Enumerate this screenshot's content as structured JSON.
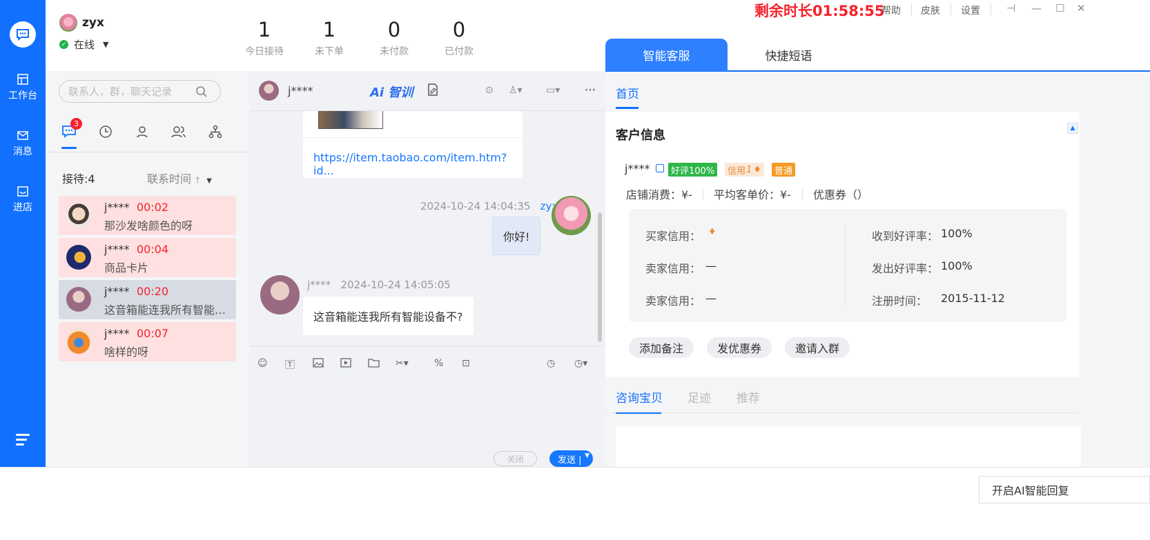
{
  "nav": {
    "items": [
      {
        "label": "工作台",
        "icon": "workbench-icon"
      },
      {
        "label": "消息",
        "icon": "mail-icon"
      },
      {
        "label": "进店",
        "icon": "store-icon"
      }
    ]
  },
  "header": {
    "user_name": "zyx",
    "status": "在线",
    "stats": [
      {
        "value": "1",
        "label": "今日接待"
      },
      {
        "value": "1",
        "label": "未下单"
      },
      {
        "value": "0",
        "label": "未付款"
      },
      {
        "value": "0",
        "label": "已付款"
      }
    ],
    "timer": "剩余时长01:58:55",
    "links": {
      "help": "帮助",
      "skin": "皮肤",
      "settings": "设置"
    }
  },
  "contacts": {
    "search_placeholder": "联系人，群，聊天记录",
    "badge": "3",
    "queue_label": "接待:4",
    "sort_label": "联系时间",
    "items": [
      {
        "name": "j****",
        "time": "00:02",
        "message": "那沙发啥颜色的呀"
      },
      {
        "name": "j****",
        "time": "00:04",
        "message": "商品卡片"
      },
      {
        "name": "j****",
        "time": "00:20",
        "message": "这音箱能连我所有智能设备不?"
      },
      {
        "name": "j****",
        "time": "00:07",
        "message": "啥样的呀"
      }
    ]
  },
  "chat": {
    "name": "j****",
    "ai_label": "Ai 智训",
    "link": "https://item.taobao.com/item.htm?id...",
    "messages": [
      {
        "time": "2024-10-24 14:04:35",
        "sender": "zyx",
        "text": "你好!"
      },
      {
        "time": "2024-10-24 14:05:05",
        "sender": "j****",
        "text": "这音箱能连我所有智能设备不?"
      }
    ],
    "close_label": "关闭",
    "send_label": "发送 |"
  },
  "right_tabs": {
    "smart": "智能客服",
    "quick": "快捷短语"
  },
  "panel": {
    "home_tab": "首页",
    "title": "客户信息",
    "customer": "j****",
    "tags": {
      "good": "好评100%",
      "credit": "信用",
      "credit_level": "1",
      "normal": "普通"
    },
    "spend": {
      "shop": "店铺消费：¥-",
      "avg": "平均客单价：¥-",
      "coupon": "优惠券（）"
    },
    "details": {
      "buyer_credit_label": "买家信用：",
      "seller_credit_label_1": "卖家信用：",
      "seller_credit_val_1": "—",
      "seller_credit_label_2": "卖家信用：",
      "seller_credit_val_2": "—",
      "received_label": "收到好评率：",
      "received_val": "100%",
      "given_label": "发出好评率：",
      "given_val": "100%",
      "reg_label": "注册时间：",
      "reg_val": "2015-11-12"
    },
    "actions": [
      "添加备注",
      "发优惠券",
      "邀请入群"
    ],
    "bottom_tabs": [
      "咨询宝贝",
      "足迹",
      "推荐"
    ]
  },
  "bottom": {
    "ai_reply": "开启AI智能回复"
  },
  "colors": {
    "brand": "#1270ff",
    "alert": "#f5222d",
    "good": "#2fb64a"
  }
}
